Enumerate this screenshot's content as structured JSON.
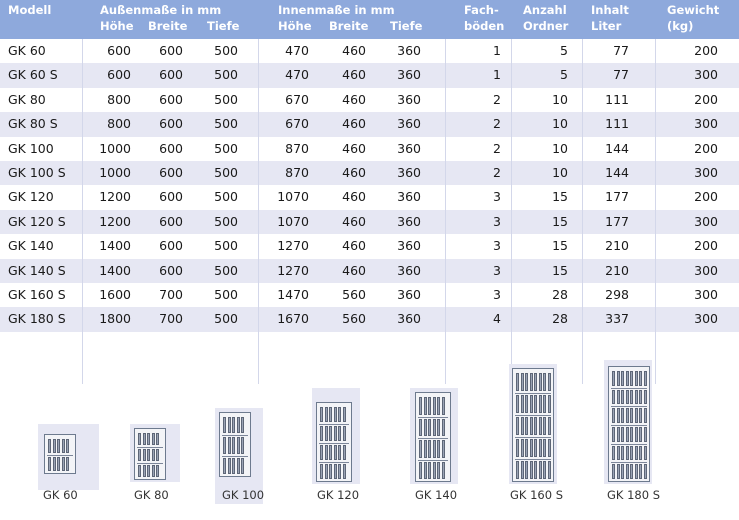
{
  "table": {
    "headers": {
      "modell": "Modell",
      "aussen": "Außenmaße in mm",
      "innen": "Innenmaße in mm",
      "hoehe": "Höhe",
      "breite": "Breite",
      "tiefe": "Tiefe",
      "fach1": "Fach-",
      "fach2": "böden",
      "anzahl1": "Anzahl",
      "anzahl2": "Ordner",
      "inhalt1": "Inhalt",
      "inhalt2": "Liter",
      "gewicht1": "Gewicht",
      "gewicht2": "(kg)"
    },
    "rows": [
      {
        "modell": "GK 60",
        "ah": "600",
        "ab": "600",
        "at": "500",
        "ih": "470",
        "ib": "460",
        "it": "360",
        "fach": "1",
        "ordner": "5",
        "liter": "77",
        "gewicht": "200"
      },
      {
        "modell": "GK 60 S",
        "ah": "600",
        "ab": "600",
        "at": "500",
        "ih": "470",
        "ib": "460",
        "it": "360",
        "fach": "1",
        "ordner": "5",
        "liter": "77",
        "gewicht": "300"
      },
      {
        "modell": "GK 80",
        "ah": "800",
        "ab": "600",
        "at": "500",
        "ih": "670",
        "ib": "460",
        "it": "360",
        "fach": "2",
        "ordner": "10",
        "liter": "111",
        "gewicht": "200"
      },
      {
        "modell": "GK 80 S",
        "ah": "800",
        "ab": "600",
        "at": "500",
        "ih": "670",
        "ib": "460",
        "it": "360",
        "fach": "2",
        "ordner": "10",
        "liter": "111",
        "gewicht": "300"
      },
      {
        "modell": "GK 100",
        "ah": "1000",
        "ab": "600",
        "at": "500",
        "ih": "870",
        "ib": "460",
        "it": "360",
        "fach": "2",
        "ordner": "10",
        "liter": "144",
        "gewicht": "200"
      },
      {
        "modell": "GK 100 S",
        "ah": "1000",
        "ab": "600",
        "at": "500",
        "ih": "870",
        "ib": "460",
        "it": "360",
        "fach": "2",
        "ordner": "10",
        "liter": "144",
        "gewicht": "300"
      },
      {
        "modell": "GK 120",
        "ah": "1200",
        "ab": "600",
        "at": "500",
        "ih": "1070",
        "ib": "460",
        "it": "360",
        "fach": "3",
        "ordner": "15",
        "liter": "177",
        "gewicht": "200"
      },
      {
        "modell": "GK 120 S",
        "ah": "1200",
        "ab": "600",
        "at": "500",
        "ih": "1070",
        "ib": "460",
        "it": "360",
        "fach": "3",
        "ordner": "15",
        "liter": "177",
        "gewicht": "300"
      },
      {
        "modell": "GK 140",
        "ah": "1400",
        "ab": "600",
        "at": "500",
        "ih": "1270",
        "ib": "460",
        "it": "360",
        "fach": "3",
        "ordner": "15",
        "liter": "210",
        "gewicht": "200"
      },
      {
        "modell": "GK 140 S",
        "ah": "1400",
        "ab": "600",
        "at": "500",
        "ih": "1270",
        "ib": "460",
        "it": "360",
        "fach": "3",
        "ordner": "15",
        "liter": "210",
        "gewicht": "300"
      },
      {
        "modell": "GK 160 S",
        "ah": "1600",
        "ab": "700",
        "at": "500",
        "ih": "1470",
        "ib": "560",
        "it": "360",
        "fach": "3",
        "ordner": "28",
        "liter": "298",
        "gewicht": "300"
      },
      {
        "modell": "GK 180 S",
        "ah": "1800",
        "ab": "700",
        "at": "500",
        "ih": "1670",
        "ib": "560",
        "it": "360",
        "fach": "4",
        "ordner": "28",
        "liter": "337",
        "gewicht": "300"
      }
    ]
  },
  "cabinets": [
    {
      "label": "GK 60"
    },
    {
      "label": "GK 80"
    },
    {
      "label": "GK 100"
    },
    {
      "label": "GK 120"
    },
    {
      "label": "GK 140"
    },
    {
      "label": "GK 160 S"
    },
    {
      "label": "GK 180 S"
    }
  ],
  "colors": {
    "header": "#8ea9dc",
    "stripe": "#e6e7f3",
    "cabinet_outline": "#6d7a8e"
  }
}
